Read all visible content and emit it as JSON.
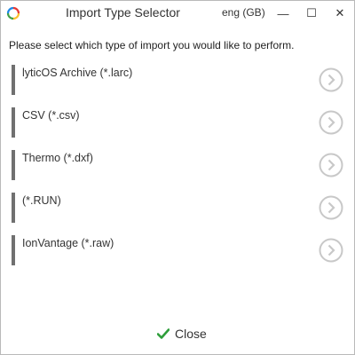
{
  "window": {
    "title": "Import Type Selector",
    "language": "eng (GB)",
    "controls": {
      "minimize_glyph": "—",
      "maximize_glyph": "☐",
      "close_glyph": "✕"
    },
    "icon": "app-ring-icon"
  },
  "main": {
    "prompt": "Please select which type of import you would like to perform.",
    "options": [
      {
        "label": "lyticOS Archive (*.larc)",
        "icon": "chevron-right-circle-icon"
      },
      {
        "label": "CSV (*.csv)",
        "icon": "chevron-right-circle-icon"
      },
      {
        "label": "Thermo (*.dxf)",
        "icon": "chevron-right-circle-icon"
      },
      {
        "label": "(*.RUN)",
        "icon": "chevron-right-circle-icon"
      },
      {
        "label": "IonVantage (*.raw)",
        "icon": "chevron-right-circle-icon"
      }
    ]
  },
  "footer": {
    "close_label": "Close",
    "close_icon": "checkmark-icon"
  },
  "colors": {
    "accent_bar": "#707070",
    "chevron": "#c8c8c8",
    "check": "#2e9e3a"
  }
}
